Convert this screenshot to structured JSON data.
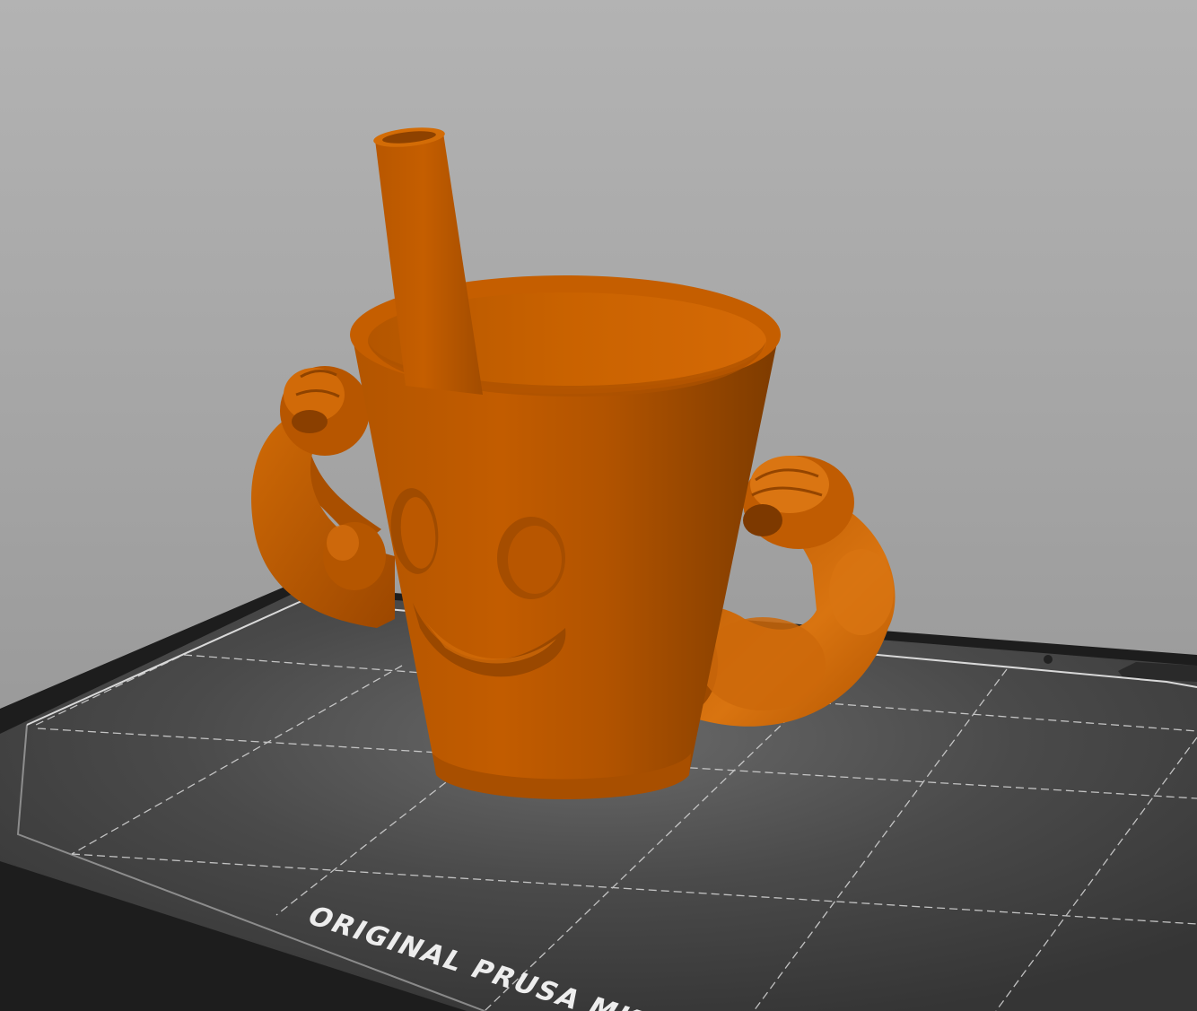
{
  "viewport": {
    "background_top": "#b3b3b3",
    "background_bottom": "#8f8f8f"
  },
  "bed": {
    "label": "ORIGINAL PRUSA MK",
    "surface_color": "#3b3b3b",
    "edge_color": "#1a1a1a",
    "grid_color": "#d9d9d9",
    "label_color": "#ededed"
  },
  "model": {
    "name": "smiling cup with straw and flexing arms",
    "color": "#c55e00",
    "shadow_color": "#8f4200",
    "highlight_color": "#e07a12"
  }
}
